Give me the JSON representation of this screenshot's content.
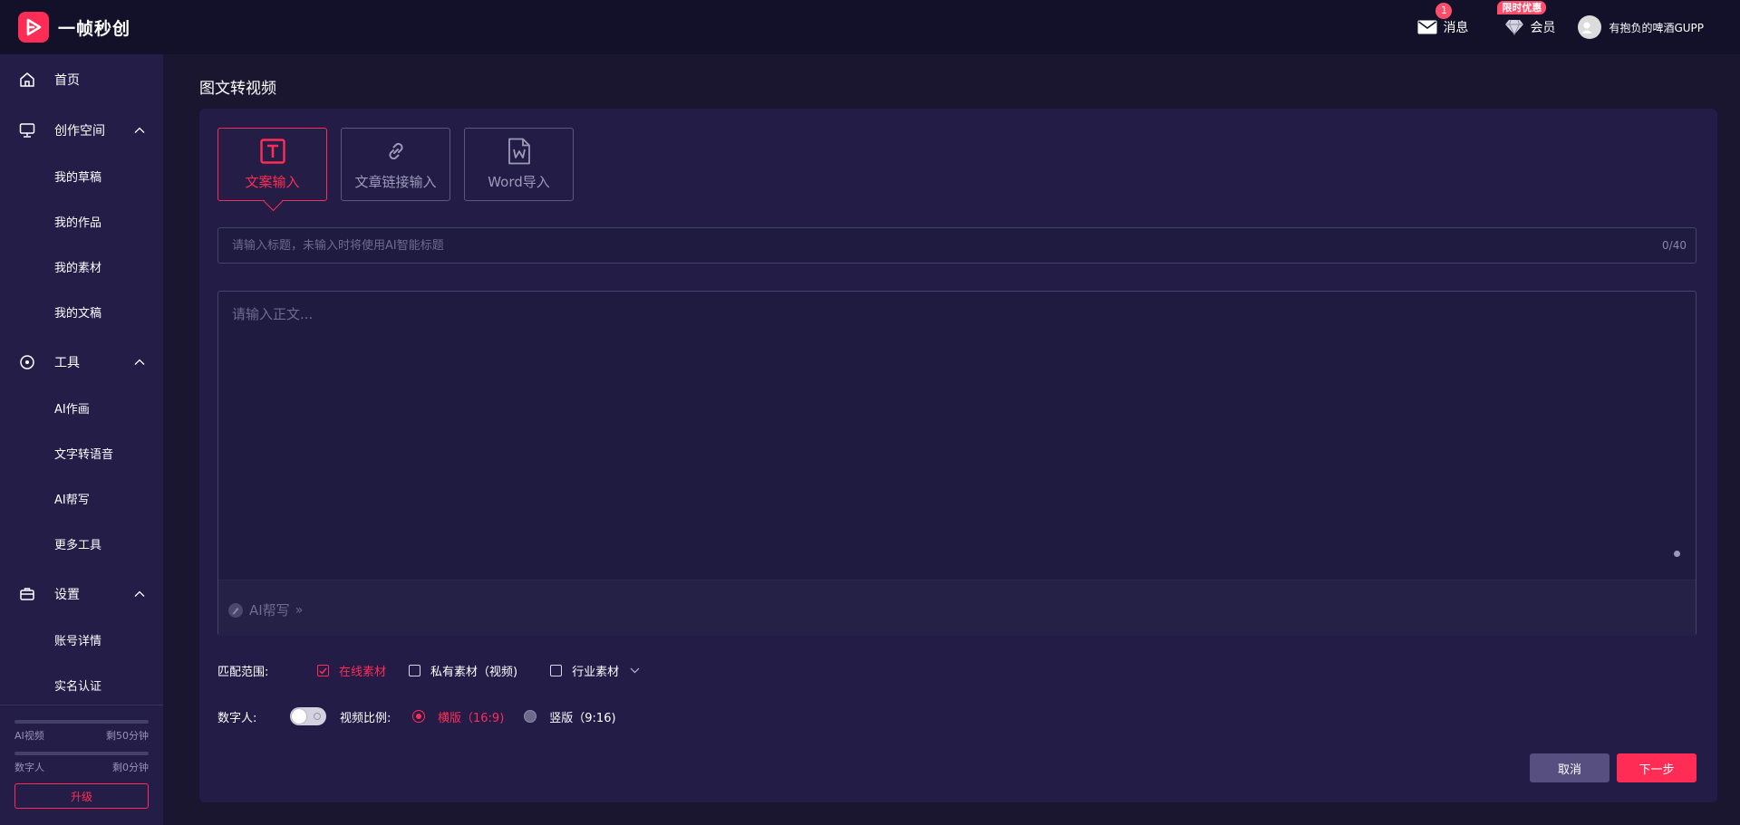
{
  "app": {
    "name": "一帧秒创",
    "accent_color": "#ff2d55"
  },
  "header": {
    "messages_label": "消息",
    "messages_badge": "1",
    "vip_label": "会员",
    "vip_promo": "限时优惠",
    "username": "有抱负的啤酒GUPP"
  },
  "sidebar": {
    "home": "首页",
    "creation_space": "创作空间",
    "creation_items": [
      "我的草稿",
      "我的作品",
      "我的素材",
      "我的文稿"
    ],
    "tools": "工具",
    "tool_items": [
      "AI作画",
      "文字转语音",
      "AI帮写",
      "更多工具"
    ],
    "settings": "设置",
    "settings_items": [
      "账号详情",
      "实名认证"
    ],
    "quota": [
      {
        "label": "AI视频",
        "remaining": "剩50分钟",
        "fraction": 0
      },
      {
        "label": "数字人",
        "remaining": "剩0分钟",
        "fraction": 0
      }
    ],
    "upgrade_label": "升级"
  },
  "main": {
    "page_title": "图文转视频",
    "tabs": [
      {
        "label": "文案输入",
        "icon": "text-icon",
        "active": true
      },
      {
        "label": "文章链接输入",
        "icon": "link-icon",
        "active": false
      },
      {
        "label": "Word导入",
        "icon": "word-file-icon",
        "active": false
      }
    ],
    "title_field": {
      "value": "",
      "placeholder": "请输入标题，未输入时将使用AI智能标题",
      "counter": "0/40"
    },
    "body_field": {
      "value": "",
      "placeholder": "请输入正文..."
    },
    "ai_help_label": "AI帮写",
    "ai_help_arrows": "»",
    "match_range": {
      "label": "匹配范围:",
      "options": [
        {
          "label": "在线素材",
          "checked": true
        },
        {
          "label": "私有素材（视频)",
          "checked": false
        },
        {
          "label": "行业素材",
          "checked": false
        }
      ]
    },
    "digital_person": {
      "label": "数字人:",
      "enabled": false
    },
    "aspect_ratio": {
      "label": "视频比例:",
      "options": [
        {
          "label": "横版（16:9)",
          "selected": true
        },
        {
          "label": "竖版（9:16)",
          "selected": false
        }
      ]
    },
    "cancel_label": "取消",
    "next_label": "下一步"
  }
}
